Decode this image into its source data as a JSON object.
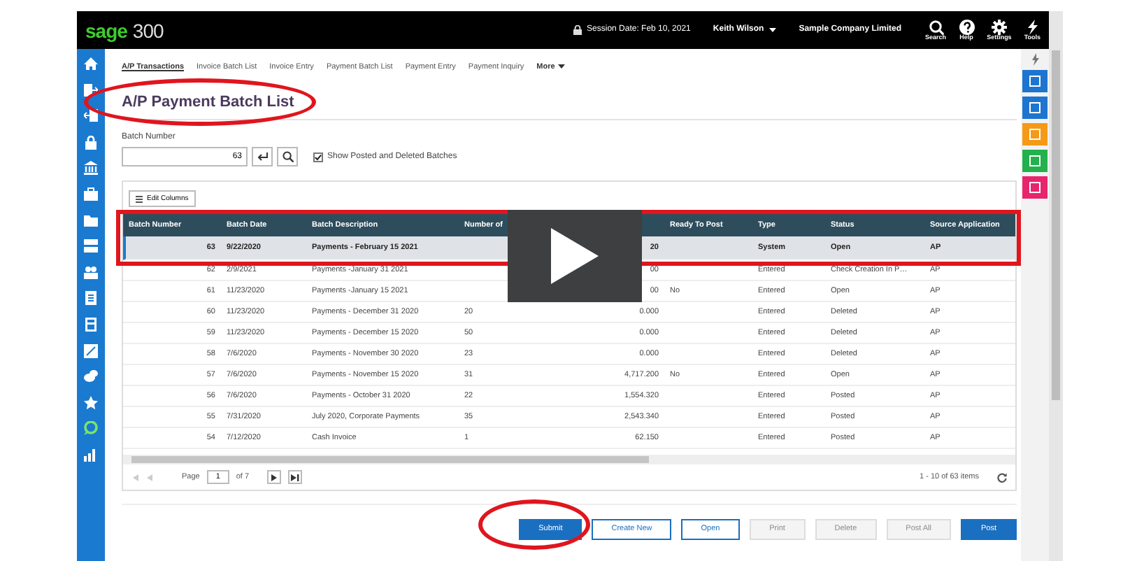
{
  "header": {
    "logo_brand": "sage",
    "logo_number": "300",
    "session": "Session Date:  Feb 10, 2021",
    "user": "Keith Wilson",
    "company": "Sample Company Limited",
    "tools": [
      {
        "label": "Search",
        "kind": "search"
      },
      {
        "label": "Help",
        "kind": "help"
      },
      {
        "label": "Settings",
        "kind": "settings"
      },
      {
        "label": "Tools",
        "kind": "tools"
      }
    ]
  },
  "breadcrumbs": [
    {
      "label": "A/P Transactions",
      "selected": true
    },
    {
      "label": "Invoice Batch List",
      "selected": false
    },
    {
      "label": "Invoice Entry",
      "selected": false
    },
    {
      "label": "Payment Batch List",
      "selected": false
    },
    {
      "label": "Payment Entry",
      "selected": false
    },
    {
      "label": "Payment Inquiry",
      "selected": false
    },
    {
      "label": "More",
      "selected": false,
      "kind": "menu"
    }
  ],
  "title": "A/P Payment Batch List",
  "batch_number": {
    "label": "Batch Number",
    "value": "63"
  },
  "show_posted": {
    "label": "Show Posted and Deleted Batches",
    "checked": true
  },
  "edit_columns": "Edit Columns",
  "table": {
    "columns": {
      "batch_number": "Batch Number",
      "batch_date": "Batch Date",
      "description": "Batch Description",
      "entries": "Number of",
      "ready_to_post": "Ready To Post",
      "type": "Type",
      "status": "Status",
      "source_application": "Source Application"
    },
    "rows": [
      {
        "batch_number": "63",
        "batch_date": "9/22/2020",
        "description": "Payments - February 15 2021",
        "amount": "20",
        "type": "System",
        "status": "Open",
        "source_application": "AP",
        "selected": true
      },
      {
        "batch_number": "62",
        "batch_date": "2/9/2021",
        "description": "Payments -January 31 2021",
        "amount": "00",
        "type": "Entered",
        "status": "Check Creation In P…",
        "source_application": "AP",
        "selected": false
      },
      {
        "batch_number": "61",
        "batch_date": "11/23/2020",
        "description": "Payments -January 15 2021",
        "amount": "00",
        "ready_to_post": "No",
        "type": "Entered",
        "status": "Open",
        "source_application": "AP",
        "selected": false
      },
      {
        "batch_number": "60",
        "batch_date": "11/23/2020",
        "description": "Payments - December 31 2020",
        "entries": "20",
        "amount": "0.000",
        "type": "Entered",
        "status": "Deleted",
        "source_application": "AP",
        "selected": false
      },
      {
        "batch_number": "59",
        "batch_date": "11/23/2020",
        "description": "Payments - December 15 2020",
        "entries": "50",
        "amount": "0.000",
        "type": "Entered",
        "status": "Deleted",
        "source_application": "AP",
        "selected": false
      },
      {
        "batch_number": "58",
        "batch_date": "7/6/2020",
        "description": "Payments - November 30 2020",
        "entries": "23",
        "amount": "0.000",
        "type": "Entered",
        "status": "Deleted",
        "source_application": "AP",
        "selected": false
      },
      {
        "batch_number": "57",
        "batch_date": "7/6/2020",
        "description": "Payments - November 15 2020",
        "entries": "31",
        "amount": "4,717.200",
        "ready_to_post": "No",
        "type": "Entered",
        "status": "Open",
        "source_application": "AP",
        "selected": false
      },
      {
        "batch_number": "56",
        "batch_date": "7/6/2020",
        "description": "Payments - October 31 2020",
        "entries": "22",
        "amount": "1,554.320",
        "type": "Entered",
        "status": "Posted",
        "source_application": "AP",
        "selected": false
      },
      {
        "batch_number": "55",
        "batch_date": "7/31/2020",
        "description": "July 2020, Corporate Payments",
        "entries": "35",
        "amount": "2,543.340",
        "type": "Entered",
        "status": "Posted",
        "source_application": "AP",
        "selected": false
      },
      {
        "batch_number": "54",
        "batch_date": "7/12/2020",
        "description": "Cash Invoice",
        "entries": "1",
        "amount": "62.150",
        "type": "Entered",
        "status": "Posted",
        "source_application": "AP",
        "selected": false
      }
    ]
  },
  "pager": {
    "page_label": "Page",
    "page": "1",
    "of": "of 7",
    "summary": "1 - 10 of 63 items"
  },
  "buttons": [
    {
      "label": "Submit",
      "kind": "primary",
      "disabled": false
    },
    {
      "label": "Create New",
      "kind": "outline",
      "disabled": false
    },
    {
      "label": "Open",
      "kind": "outline",
      "disabled": false
    },
    {
      "label": "Print",
      "kind": "outline",
      "disabled": true
    },
    {
      "label": "Delete",
      "kind": "outline",
      "disabled": true
    },
    {
      "label": "Post All",
      "kind": "outline",
      "disabled": true
    },
    {
      "label": "Post",
      "kind": "primary",
      "disabled": false
    }
  ]
}
